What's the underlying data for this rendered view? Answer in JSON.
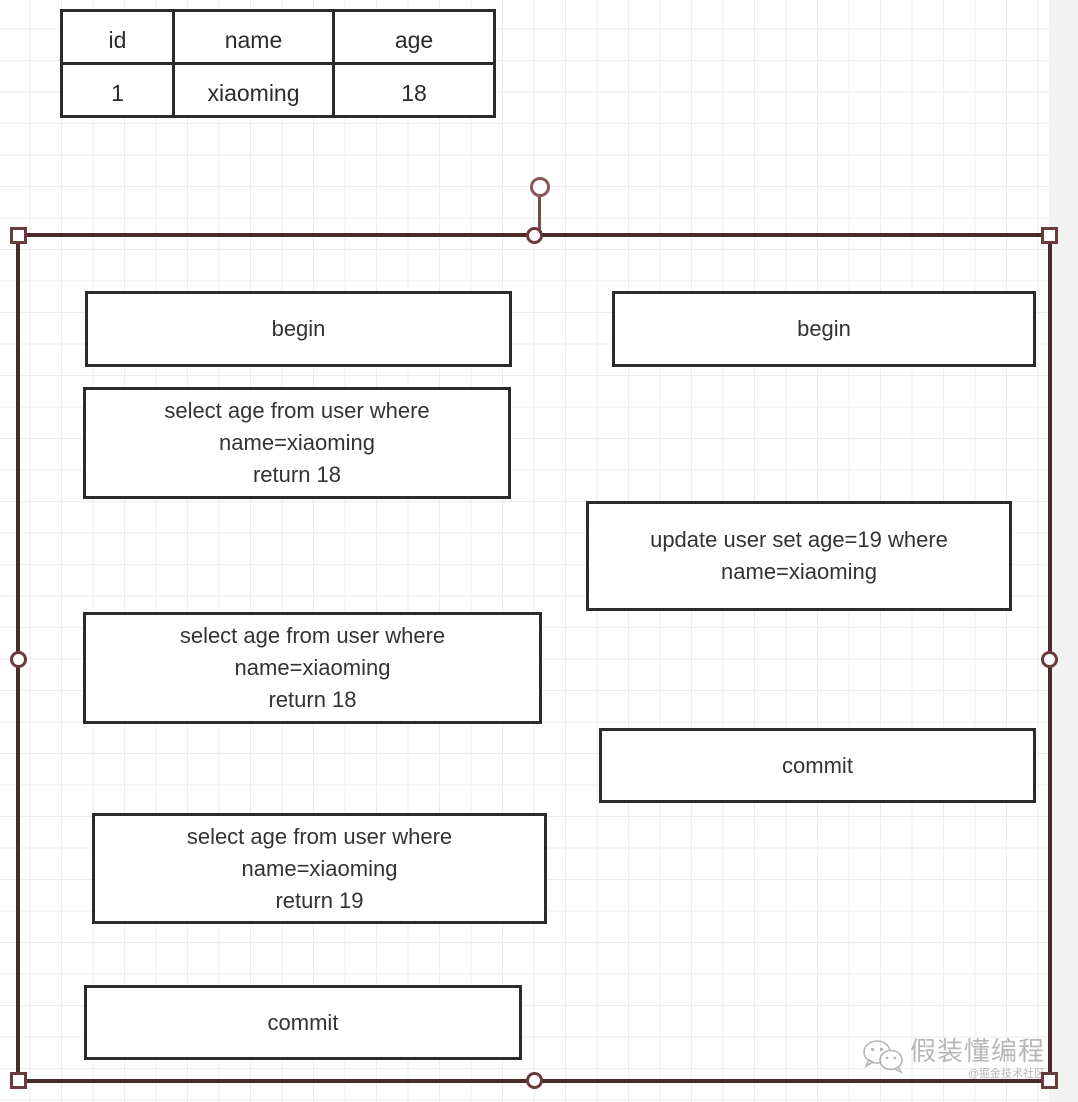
{
  "canvas": {
    "background_color": "#ffffff",
    "gutter_color": "#f2f2f2",
    "grid_line_color": "#ededed",
    "grid_spacing_px": 31.5
  },
  "data_table": {
    "name": "user",
    "headers": [
      "id",
      "name",
      "age"
    ],
    "rows": [
      [
        "1",
        "xiaoming",
        "18"
      ]
    ]
  },
  "selection": {
    "border_color": "#4a2b2b",
    "handle_border_color": "#6b3a3a",
    "handle_fill_color": "#ffffff",
    "rotate_handle_color": "#8a5656"
  },
  "diagram": {
    "box_border_color": "#2b2b2b",
    "box_text_color": "#333333",
    "left_transaction": [
      {
        "id": "left-begin",
        "text": "begin"
      },
      {
        "id": "left-select-1",
        "text": "select age from user where\nname=xiaoming\nreturn 18"
      },
      {
        "id": "left-select-2",
        "text": "select age from user where\nname=xiaoming\nreturn 18"
      },
      {
        "id": "left-select-3",
        "text": "select age from user where\nname=xiaoming\nreturn 19"
      },
      {
        "id": "left-commit",
        "text": "commit"
      }
    ],
    "right_transaction": [
      {
        "id": "right-begin",
        "text": "begin"
      },
      {
        "id": "right-update",
        "text": "update user set age=19 where\nname=xiaoming"
      },
      {
        "id": "right-commit",
        "text": "commit"
      }
    ]
  },
  "watermark": {
    "icon": "wechat-icon",
    "title": "假装懂编程",
    "subtitle": "@掘金技术社区"
  }
}
